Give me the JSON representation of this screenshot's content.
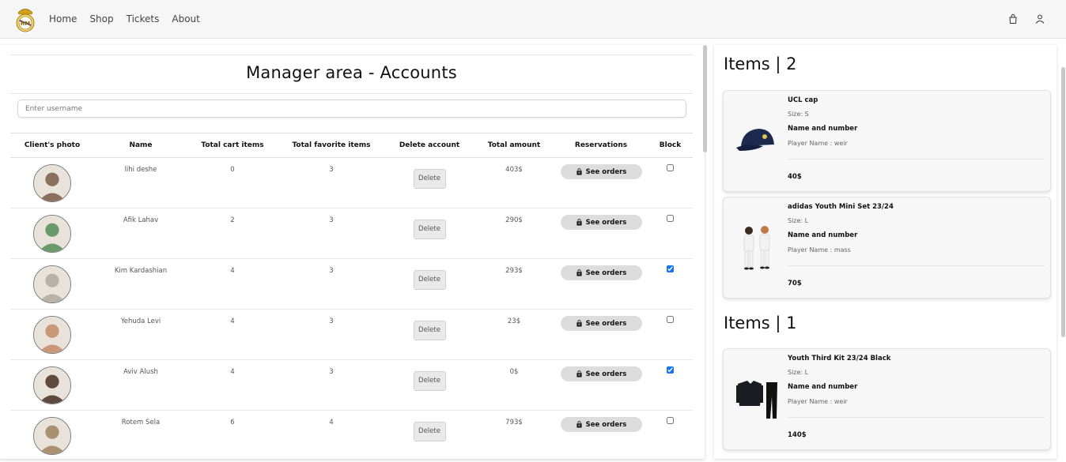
{
  "nav": {
    "links": [
      "Home",
      "Shop",
      "Tickets",
      "About"
    ],
    "icons": [
      "cart-icon",
      "user-icon"
    ]
  },
  "manager": {
    "title": "Manager area - Accounts",
    "search_placeholder": "Enter username"
  },
  "table": {
    "headers": [
      "Client's photo",
      "Name",
      "Total cart items",
      "Total favorite items",
      "Delete account",
      "Total amount",
      "Reservations",
      "Block"
    ],
    "delete_label": "Delete",
    "orders_label": "See orders",
    "rows": [
      {
        "name": "lihi deshe",
        "cart": "0",
        "fav": "3",
        "amount": "403$",
        "blocked": false,
        "avatar_color": "#8a6f5c"
      },
      {
        "name": "Afik Lahav",
        "cart": "2",
        "fav": "3",
        "amount": "290$",
        "blocked": false,
        "avatar_color": "#6a9a6a"
      },
      {
        "name": "Kim Kardashian",
        "cart": "4",
        "fav": "3",
        "amount": "293$",
        "blocked": true,
        "avatar_color": "#b9b2a9"
      },
      {
        "name": "Yehuda Levi",
        "cart": "4",
        "fav": "3",
        "amount": "23$",
        "blocked": false,
        "avatar_color": "#c89878"
      },
      {
        "name": "Aviv Alush",
        "cart": "4",
        "fav": "3",
        "amount": "0$",
        "blocked": true,
        "avatar_color": "#5e4a3e"
      },
      {
        "name": "Rotem Sela",
        "cart": "6",
        "fav": "4",
        "amount": "793$",
        "blocked": false,
        "avatar_color": "#a89070"
      }
    ]
  },
  "orders": {
    "groups": [
      {
        "heading": "Items | 2"
      },
      {
        "heading": "Items | 1"
      }
    ],
    "size_prefix": "Size: ",
    "nn_label": "Name and number",
    "player_prefix": "Player Name : ",
    "items": [
      {
        "name": "UCL cap",
        "size": "Size: S",
        "player": "Player Name : weir",
        "price": "40$",
        "icon": "cap-image"
      },
      {
        "name": "adidas Youth Mini Set 23/24",
        "size": "Size: L",
        "player": "Player Name : mass",
        "price": "70$",
        "icon": "kids-kit-image"
      },
      {
        "name": "Youth Third Kit 23/24 Black",
        "size": "Size: L",
        "player": "Player Name : weir",
        "price": "140$",
        "icon": "tracksuit-image"
      }
    ]
  },
  "colors": {
    "navbar_bg": "#f6f6f6",
    "checkbox_accent": "#1a73e8",
    "orders_button_bg": "#dcdcdc"
  }
}
